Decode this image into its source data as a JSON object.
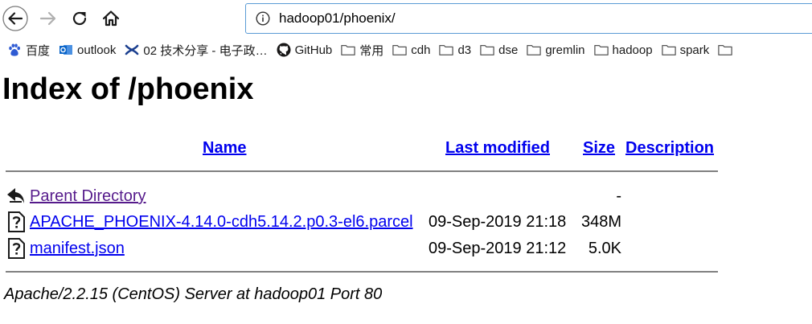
{
  "browser": {
    "url_host": "hadoop01/",
    "url_path": "phoenix/"
  },
  "bookmarks": [
    {
      "label": "百度",
      "icon": "baidu-icon"
    },
    {
      "label": "outlook",
      "icon": "outlook-icon"
    },
    {
      "label": "02 技术分享 - 电子政…",
      "icon": "confluence-icon"
    },
    {
      "label": "GitHub",
      "icon": "github-icon"
    },
    {
      "label": "常用",
      "icon": "folder-icon"
    },
    {
      "label": "cdh",
      "icon": "folder-icon"
    },
    {
      "label": "d3",
      "icon": "folder-icon"
    },
    {
      "label": "dse",
      "icon": "folder-icon"
    },
    {
      "label": "gremlin",
      "icon": "folder-icon"
    },
    {
      "label": "hadoop",
      "icon": "folder-icon"
    },
    {
      "label": "spark",
      "icon": "folder-icon"
    }
  ],
  "page": {
    "title": "Index of /phoenix",
    "columns": {
      "name": "Name",
      "last_modified": "Last modified",
      "size": "Size",
      "description": "Description"
    },
    "rows": [
      {
        "name": "Parent Directory",
        "date": "",
        "size": "-",
        "icon": "back-icon"
      },
      {
        "name": "APACHE_PHOENIX-4.14.0-cdh5.14.2.p0.3-el6.parcel",
        "date": "09-Sep-2019 21:18",
        "size": "348M",
        "icon": "unknown-file-icon"
      },
      {
        "name": "manifest.json",
        "date": "09-Sep-2019 21:12",
        "size": "5.0K",
        "icon": "unknown-file-icon"
      }
    ],
    "footer": "Apache/2.2.15 (CentOS) Server at hadoop01 Port 80"
  }
}
